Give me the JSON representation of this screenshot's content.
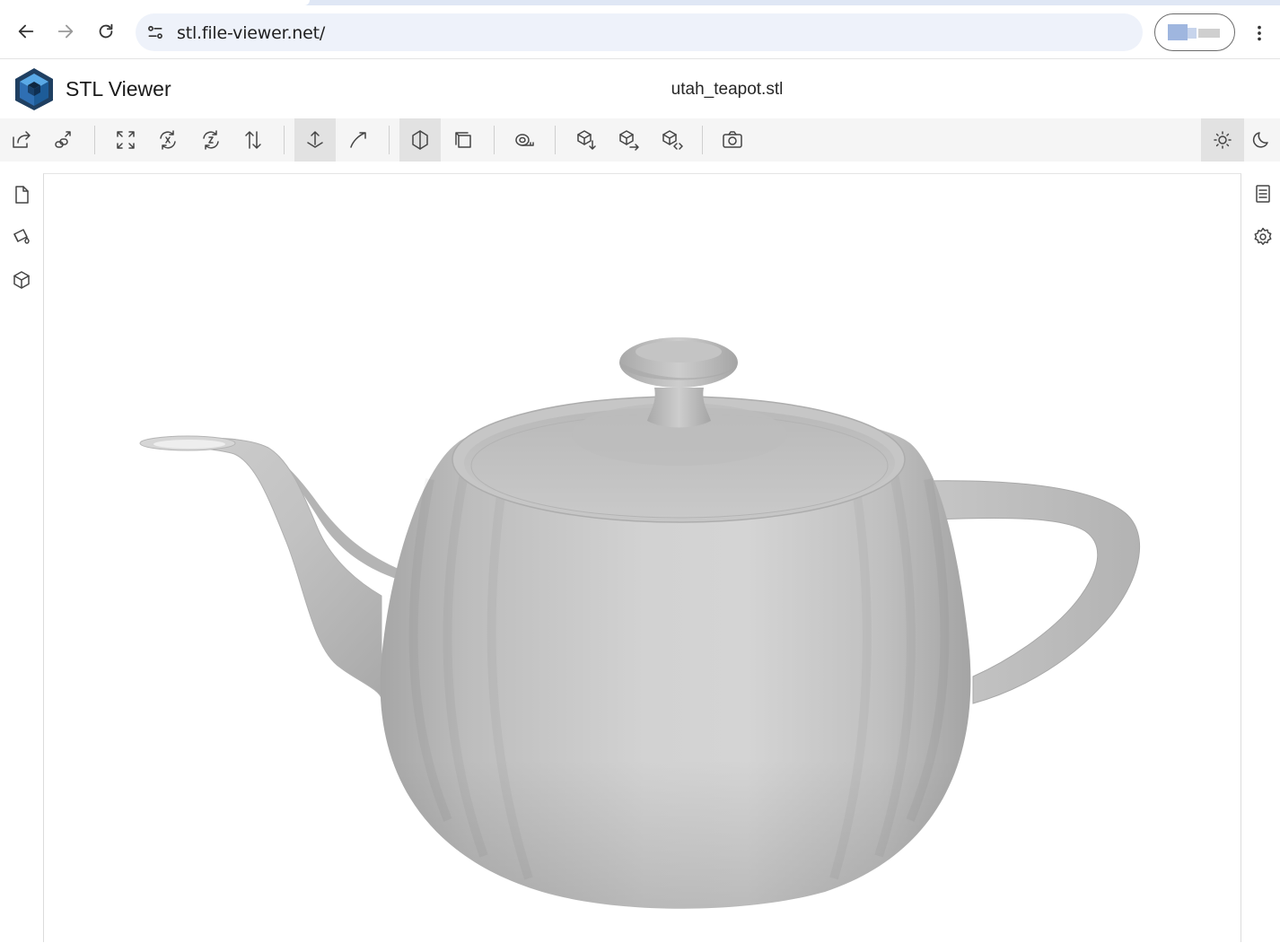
{
  "browser": {
    "url": "stl.file-viewer.net/",
    "icons": [
      "back-arrow-icon",
      "forward-arrow-icon",
      "reload-icon",
      "site-settings-icon",
      "profile-avatar-icon",
      "more-vert-icon"
    ]
  },
  "app": {
    "title": "STL Viewer",
    "file_name": "utah_teapot.stl",
    "brand_colors": {
      "logo_dark": "#1f3f61",
      "logo_mid": "#2f6fb3",
      "logo_light": "#5aa9e6"
    }
  },
  "toolbar": {
    "items": [
      {
        "icon": "open-file-icon",
        "selected": false
      },
      {
        "icon": "open-url-icon",
        "selected": false
      },
      {
        "icon": "fit-to-window-icon",
        "selected": false
      },
      {
        "icon": "rotate-x-icon",
        "selected": false
      },
      {
        "icon": "rotate-z-icon",
        "selected": false
      },
      {
        "icon": "flip-up-vector-icon",
        "selected": false
      },
      {
        "icon": "fixed-up-vector-icon",
        "selected": true
      },
      {
        "icon": "free-orbit-icon",
        "selected": false
      },
      {
        "icon": "perspective-camera-icon",
        "selected": true
      },
      {
        "icon": "orthographic-camera-icon",
        "selected": false
      },
      {
        "icon": "measure-icon",
        "selected": false
      },
      {
        "icon": "export-model-icon",
        "selected": false
      },
      {
        "icon": "share-model-icon",
        "selected": false
      },
      {
        "icon": "embed-model-icon",
        "selected": false
      },
      {
        "icon": "snapshot-camera-icon",
        "selected": false
      },
      {
        "icon": "light-mode-icon",
        "selected": true
      },
      {
        "icon": "dark-mode-icon",
        "selected": false
      }
    ]
  },
  "left_sidebar": [
    "files-panel-icon",
    "materials-panel-icon",
    "meshes-panel-icon"
  ],
  "right_sidebar": [
    "details-panel-icon",
    "settings-gear-icon"
  ],
  "viewport": {
    "model": "teapot",
    "model_color": "#c8c8c8",
    "background": "#ffffff"
  }
}
